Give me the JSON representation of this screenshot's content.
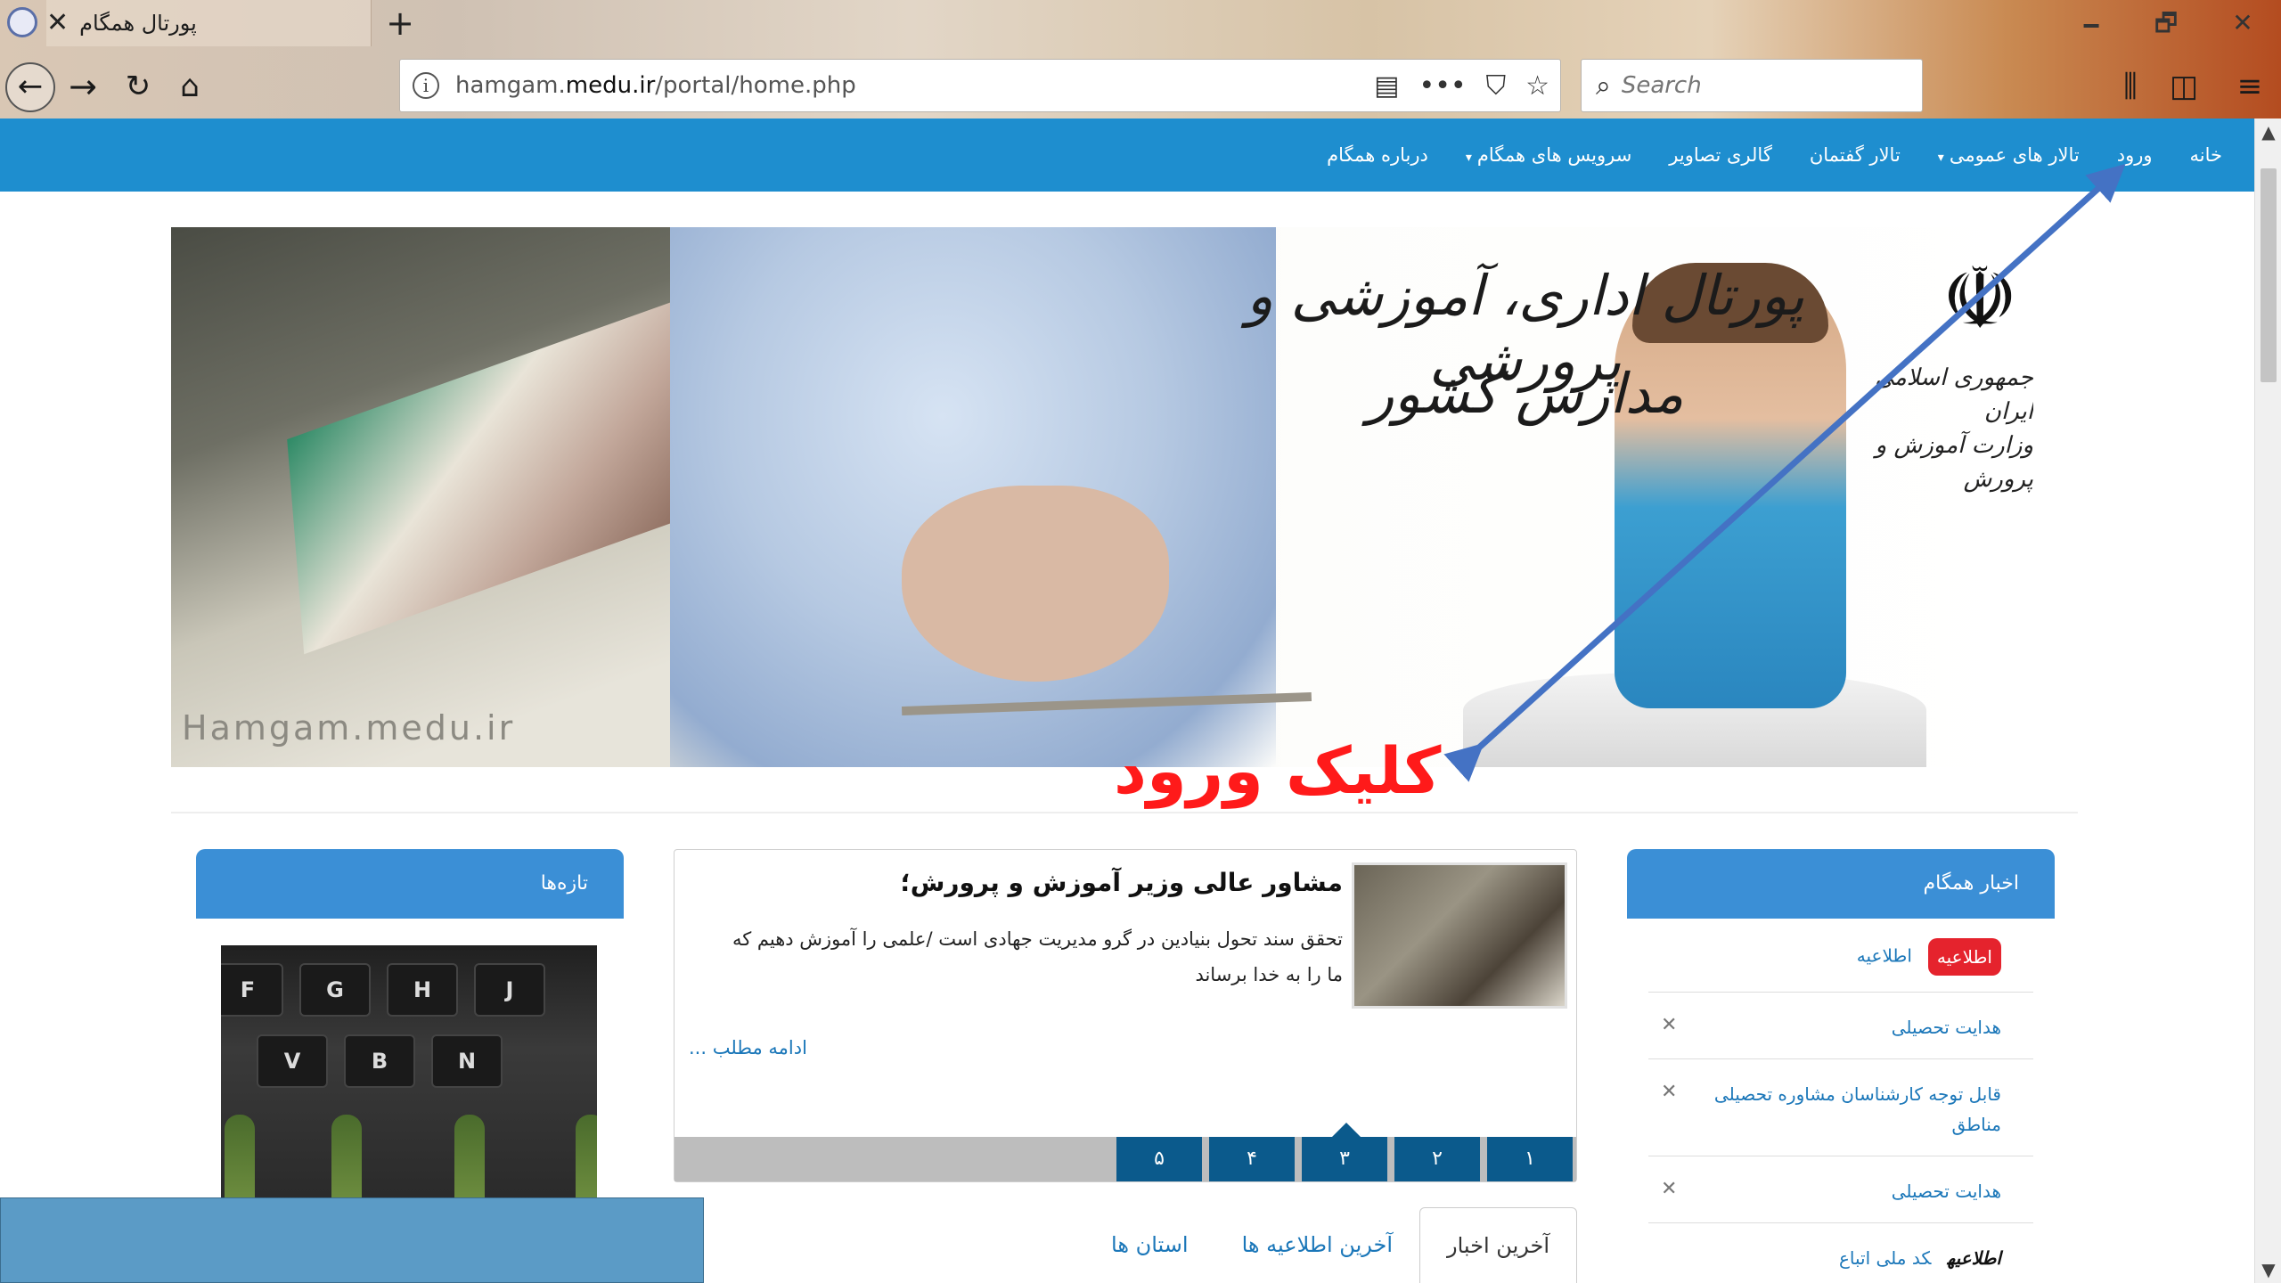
{
  "browser": {
    "tab_title": "پورتال همگام",
    "tab_close": "✕",
    "new_tab": "+",
    "url_host": "hamgam.",
    "url_domain": "medu.ir",
    "url_path": "/portal/home.php",
    "search_placeholder": "Search",
    "window_controls": {
      "minimize": "🗕",
      "restore": "🗗",
      "close": "✕"
    }
  },
  "site_nav": {
    "items": [
      {
        "label": "خانه"
      },
      {
        "label": "ورود"
      },
      {
        "label": "تالار های عمومی",
        "caret": "▾"
      },
      {
        "label": "تالار گفتمان"
      },
      {
        "label": "گالری تصاویر"
      },
      {
        "label": "سرویس های همگام",
        "caret": "▾"
      },
      {
        "label": "درباره همگام"
      }
    ]
  },
  "banner": {
    "title": "پورتال اداری، آموزشی و پرورشی",
    "subtitle": "مدارس کشور",
    "emblem_line1": "جمهوری اسلامی ایران",
    "emblem_line2": "وزارت آموزش و پرورش",
    "watermark": "Hamgam.medu.ir"
  },
  "annotation": {
    "click_label": "کلیک ورود",
    "arrow_color": "#4472c4"
  },
  "news": {
    "header": "اخبار همگام",
    "items": [
      {
        "badge": "اطلاعیه",
        "text": "اطلاعیه"
      },
      {
        "text": "هدایت تحصیلی"
      },
      {
        "text": "قابل توجه کارشناسان مشاوره تحصیلی مناطق"
      },
      {
        "text": "هدایت تحصیلی"
      },
      {
        "bold": "اطلاعیه",
        "text": "کد ملی اتباع"
      }
    ]
  },
  "slider": {
    "title": "مشاور عالی وزیر آموزش و پرورش؛",
    "body": "تحقق سند تحول بنیادین در گرو مدیریت جهادی است /علمی را آموزش دهیم که ما را به خدا برساند",
    "more": "ادامه مطلب ...",
    "tabs": [
      "۱",
      "۲",
      "۳",
      "۴",
      "۵"
    ],
    "active_tab": "۳"
  },
  "bottom_tabs": [
    "آخرین اخبار",
    "آخرین اطلاعیه ها",
    "استان ها"
  ],
  "fresh": {
    "header": "تازه‌ها",
    "keys": [
      "F",
      "G",
      "H",
      "J",
      "V",
      "B",
      "N"
    ]
  },
  "colors": {
    "nav_blue": "#1e8ecf",
    "panel_blue": "#3b8fd6",
    "slider_tab": "#0b5a8c",
    "badge_red": "#e5232d",
    "annotation_red": "#ff1a1a"
  }
}
